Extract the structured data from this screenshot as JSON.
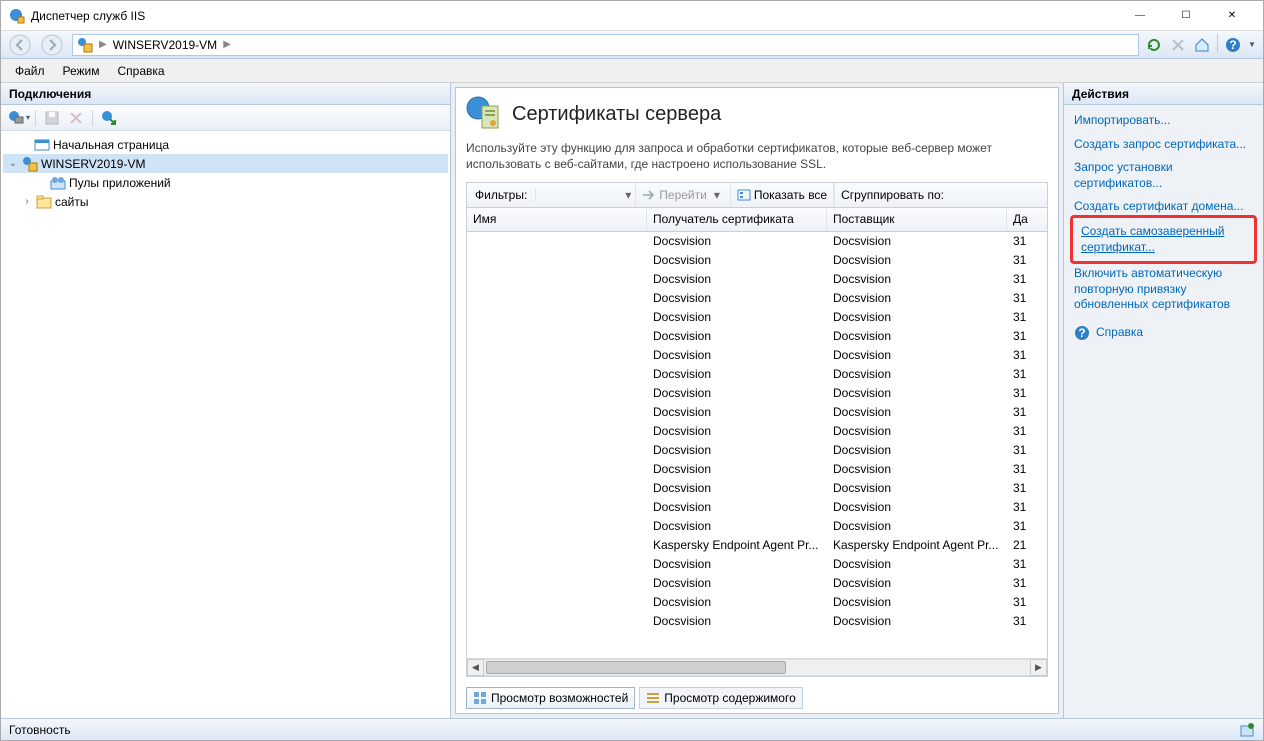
{
  "window": {
    "title": "Диспетчер служб IIS"
  },
  "breadcrumb": {
    "root": "WINSERV2019-VM"
  },
  "menu": {
    "file": "Файл",
    "mode": "Режим",
    "help": "Справка"
  },
  "left": {
    "header": "Подключения",
    "nodes": {
      "start": "Начальная страница",
      "server": "WINSERV2019-VM",
      "apppools": "Пулы приложений",
      "sites": "сайты"
    }
  },
  "page": {
    "title": "Сертификаты сервера",
    "desc": "Используйте эту функцию для запроса и обработки сертификатов, которые веб-сервер может использовать с веб-сайтами, где настроено использование SSL.",
    "filter_label": "Фильтры:",
    "go_label": "Перейти",
    "showall_label": "Показать все",
    "group_label": "Сгруппировать по:",
    "cols": {
      "name": "Имя",
      "issuedto": "Получатель сертификата",
      "issuer": "Поставщик",
      "date": "Да"
    },
    "rows": [
      {
        "name": "",
        "to": "Docsvision",
        "by": "Docsvision",
        "d": "31"
      },
      {
        "name": "",
        "to": "Docsvision",
        "by": "Docsvision",
        "d": "31"
      },
      {
        "name": "",
        "to": "Docsvision",
        "by": "Docsvision",
        "d": "31"
      },
      {
        "name": "",
        "to": "Docsvision",
        "by": "Docsvision",
        "d": "31"
      },
      {
        "name": "",
        "to": "Docsvision",
        "by": "Docsvision",
        "d": "31"
      },
      {
        "name": "",
        "to": "Docsvision",
        "by": "Docsvision",
        "d": "31"
      },
      {
        "name": "",
        "to": "Docsvision",
        "by": "Docsvision",
        "d": "31"
      },
      {
        "name": "",
        "to": "Docsvision",
        "by": "Docsvision",
        "d": "31"
      },
      {
        "name": "",
        "to": "Docsvision",
        "by": "Docsvision",
        "d": "31"
      },
      {
        "name": "",
        "to": "Docsvision",
        "by": "Docsvision",
        "d": "31"
      },
      {
        "name": "",
        "to": "Docsvision",
        "by": "Docsvision",
        "d": "31"
      },
      {
        "name": "",
        "to": "Docsvision",
        "by": "Docsvision",
        "d": "31"
      },
      {
        "name": "",
        "to": "Docsvision",
        "by": "Docsvision",
        "d": "31"
      },
      {
        "name": "",
        "to": "Docsvision",
        "by": "Docsvision",
        "d": "31"
      },
      {
        "name": "",
        "to": "Docsvision",
        "by": "Docsvision",
        "d": "31"
      },
      {
        "name": "",
        "to": "Docsvision",
        "by": "Docsvision",
        "d": "31"
      },
      {
        "name": "",
        "to": "Kaspersky Endpoint Agent Pr...",
        "by": "Kaspersky Endpoint Agent Pr...",
        "d": "21"
      },
      {
        "name": "",
        "to": "Docsvision",
        "by": "Docsvision",
        "d": "31"
      },
      {
        "name": "",
        "to": "Docsvision",
        "by": "Docsvision",
        "d": "31"
      },
      {
        "name": "",
        "to": "Docsvision",
        "by": "Docsvision",
        "d": "31"
      },
      {
        "name": "",
        "to": "Docsvision",
        "by": "Docsvision",
        "d": "31"
      }
    ],
    "viewtabs": {
      "features": "Просмотр возможностей",
      "content": "Просмотр содержимого"
    }
  },
  "actions": {
    "header": "Действия",
    "import": "Импортировать...",
    "create_req": "Создать запрос сертификата...",
    "install_req": "Запрос установки сертификатов...",
    "create_domain": "Создать сертификат домена...",
    "create_self": "Создать самозаверенный сертификат...",
    "rebind": "Включить автоматическую повторную привязку обновленных сертификатов",
    "help": "Справка"
  },
  "status": {
    "ready": "Готовность"
  }
}
